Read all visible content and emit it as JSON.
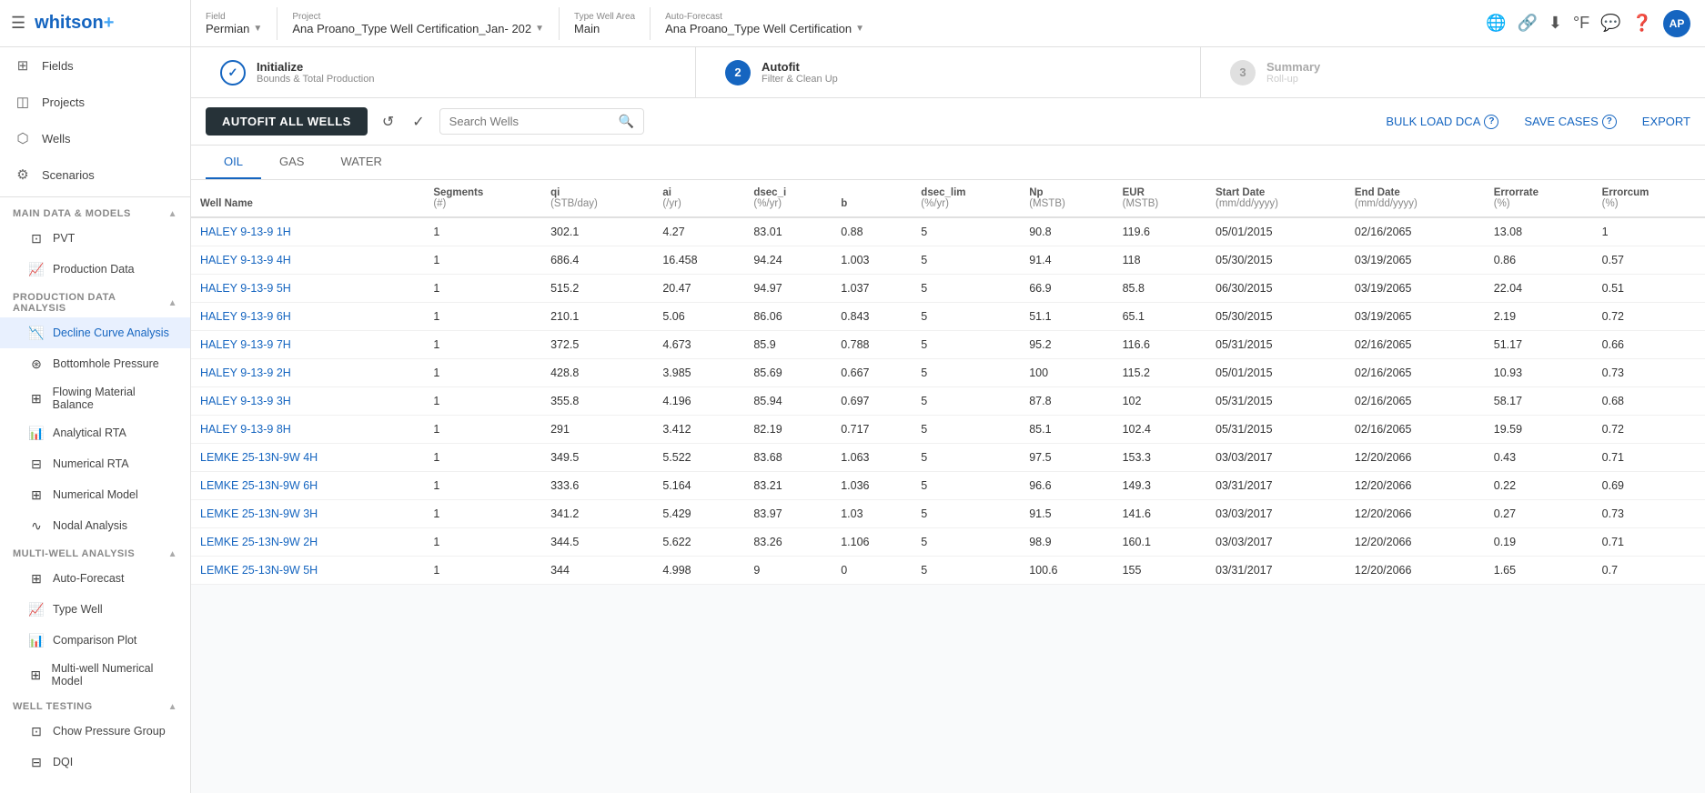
{
  "sidebar": {
    "logo": "whitson",
    "logo_plus": "+",
    "nav_items": [
      {
        "id": "fields",
        "label": "Fields",
        "icon": "⊞"
      },
      {
        "id": "projects",
        "label": "Projects",
        "icon": "📁"
      },
      {
        "id": "wells",
        "label": "Wells",
        "icon": "⬡"
      },
      {
        "id": "scenarios",
        "label": "Scenarios",
        "icon": "⚙"
      }
    ],
    "sections": [
      {
        "id": "main-data-models",
        "label": "Main Data & Models",
        "items": [
          {
            "id": "pvt",
            "label": "PVT",
            "icon": "⊡"
          },
          {
            "id": "production-data",
            "label": "Production Data",
            "icon": "📈"
          }
        ]
      },
      {
        "id": "production-data-analysis",
        "label": "Production Data Analysis",
        "items": [
          {
            "id": "decline-curve-analysis",
            "label": "Decline Curve Analysis",
            "icon": "📉",
            "active": true
          },
          {
            "id": "bottomhole-pressure",
            "label": "Bottomhole Pressure",
            "icon": "⊛"
          },
          {
            "id": "flowing-material-balance",
            "label": "Flowing Material Balance",
            "icon": "⊞"
          },
          {
            "id": "analytical-rta",
            "label": "Analytical RTA",
            "icon": "📊"
          },
          {
            "id": "numerical-rta",
            "label": "Numerical RTA",
            "icon": "⊟"
          },
          {
            "id": "numerical-model",
            "label": "Numerical Model",
            "icon": "⊞"
          },
          {
            "id": "nodal-analysis",
            "label": "Nodal Analysis",
            "icon": "∿"
          }
        ]
      },
      {
        "id": "multi-well-analysis",
        "label": "Multi-Well Analysis",
        "items": [
          {
            "id": "auto-forecast",
            "label": "Auto-Forecast",
            "icon": "⊞",
            "active": false
          },
          {
            "id": "type-well",
            "label": "Type Well",
            "icon": "📈"
          },
          {
            "id": "comparison-plot",
            "label": "Comparison Plot",
            "icon": "📊"
          },
          {
            "id": "multi-well-numerical-model",
            "label": "Multi-well Numerical Model",
            "icon": "⊞"
          }
        ]
      },
      {
        "id": "well-testing",
        "label": "Well Testing",
        "items": [
          {
            "id": "chow-pressure-group",
            "label": "Chow Pressure Group",
            "icon": "⊡"
          },
          {
            "id": "dqi",
            "label": "DQI",
            "icon": "⊟"
          }
        ]
      }
    ]
  },
  "topbar": {
    "field_label": "Field",
    "field_value": "Permian",
    "project_label": "Project",
    "project_value": "Ana Proano_Type Well Certification_Jan- 202",
    "type_well_area_label": "Type Well Area",
    "type_well_area_value": "Main",
    "auto_forecast_label": "Auto-Forecast",
    "auto_forecast_value": "Ana Proano_Type Well Certification"
  },
  "steps": [
    {
      "id": "initialize",
      "number": "✓",
      "title": "Initialize",
      "subtitle": "Bounds & Total Production",
      "state": "check"
    },
    {
      "id": "autofit",
      "number": "2",
      "title": "Autofit",
      "subtitle": "Filter & Clean Up",
      "state": "active"
    },
    {
      "id": "summary",
      "number": "3",
      "title": "Summary",
      "subtitle": "Roll-up",
      "state": "inactive"
    }
  ],
  "toolbar": {
    "autofit_button": "AUTOFIT ALL WELLS",
    "search_placeholder": "Search Wells",
    "bulk_load_dca": "BULK LOAD DCA",
    "save_cases": "SAVE CASES",
    "export": "EXPORT"
  },
  "tabs": [
    {
      "id": "oil",
      "label": "OIL",
      "active": true
    },
    {
      "id": "gas",
      "label": "GAS",
      "active": false
    },
    {
      "id": "water",
      "label": "WATER",
      "active": false
    }
  ],
  "table": {
    "columns": [
      {
        "id": "well-name",
        "label": "Well Name",
        "unit": ""
      },
      {
        "id": "segments",
        "label": "Segments",
        "unit": "(#)"
      },
      {
        "id": "qi",
        "label": "qi",
        "unit": "(STB/day)"
      },
      {
        "id": "ai",
        "label": "ai",
        "unit": "(/yr)"
      },
      {
        "id": "dsec_i",
        "label": "dsec_i",
        "unit": "(%/yr)"
      },
      {
        "id": "b",
        "label": "b",
        "unit": ""
      },
      {
        "id": "dsec_lim",
        "label": "dsec_lim",
        "unit": "(%/yr)"
      },
      {
        "id": "np",
        "label": "Np",
        "unit": "(MSTB)"
      },
      {
        "id": "eur",
        "label": "EUR",
        "unit": "(MSTB)"
      },
      {
        "id": "start-date",
        "label": "Start Date",
        "unit": "(mm/dd/yyyy)"
      },
      {
        "id": "end-date",
        "label": "End Date",
        "unit": "(mm/dd/yyyy)"
      },
      {
        "id": "error-rate",
        "label": "Errorrate",
        "unit": "(%)"
      },
      {
        "id": "error-cum",
        "label": "Errorcum",
        "unit": "(%)"
      }
    ],
    "rows": [
      {
        "well_name": "HALEY 9-13-9 1H",
        "segments": 1,
        "qi": 302.1,
        "ai": 4.27,
        "dsec_i": 83.01,
        "b": 0.88,
        "dsec_lim": 5,
        "np": 90.8,
        "eur": 119.6,
        "start_date": "05/01/2015",
        "end_date": "02/16/2065",
        "error_rate": 13.08,
        "error_cum": 1
      },
      {
        "well_name": "HALEY 9-13-9 4H",
        "segments": 1,
        "qi": 686.4,
        "ai": 16.458,
        "dsec_i": 94.24,
        "b": 1.003,
        "dsec_lim": 5,
        "np": 91.4,
        "eur": 118,
        "start_date": "05/30/2015",
        "end_date": "03/19/2065",
        "error_rate": 0.86,
        "error_cum": 0.57
      },
      {
        "well_name": "HALEY 9-13-9 5H",
        "segments": 1,
        "qi": 515.2,
        "ai": 20.47,
        "dsec_i": 94.97,
        "b": 1.037,
        "dsec_lim": 5,
        "np": 66.9,
        "eur": 85.8,
        "start_date": "06/30/2015",
        "end_date": "03/19/2065",
        "error_rate": 22.04,
        "error_cum": 0.51
      },
      {
        "well_name": "HALEY 9-13-9 6H",
        "segments": 1,
        "qi": 210.1,
        "ai": 5.06,
        "dsec_i": 86.06,
        "b": 0.843,
        "dsec_lim": 5,
        "np": 51.1,
        "eur": 65.1,
        "start_date": "05/30/2015",
        "end_date": "03/19/2065",
        "error_rate": 2.19,
        "error_cum": 0.72
      },
      {
        "well_name": "HALEY 9-13-9 7H",
        "segments": 1,
        "qi": 372.5,
        "ai": 4.673,
        "dsec_i": 85.9,
        "b": 0.788,
        "dsec_lim": 5,
        "np": 95.2,
        "eur": 116.6,
        "start_date": "05/31/2015",
        "end_date": "02/16/2065",
        "error_rate": 51.17,
        "error_cum": 0.66
      },
      {
        "well_name": "HALEY 9-13-9 2H",
        "segments": 1,
        "qi": 428.8,
        "ai": 3.985,
        "dsec_i": 85.69,
        "b": 0.667,
        "dsec_lim": 5,
        "np": 100,
        "eur": 115.2,
        "start_date": "05/01/2015",
        "end_date": "02/16/2065",
        "error_rate": 10.93,
        "error_cum": 0.73
      },
      {
        "well_name": "HALEY 9-13-9 3H",
        "segments": 1,
        "qi": 355.8,
        "ai": 4.196,
        "dsec_i": 85.94,
        "b": 0.697,
        "dsec_lim": 5,
        "np": 87.8,
        "eur": 102,
        "start_date": "05/31/2015",
        "end_date": "02/16/2065",
        "error_rate": 58.17,
        "error_cum": 0.68
      },
      {
        "well_name": "HALEY 9-13-9 8H",
        "segments": 1,
        "qi": 291,
        "ai": 3.412,
        "dsec_i": 82.19,
        "b": 0.717,
        "dsec_lim": 5,
        "np": 85.1,
        "eur": 102.4,
        "start_date": "05/31/2015",
        "end_date": "02/16/2065",
        "error_rate": 19.59,
        "error_cum": 0.72
      },
      {
        "well_name": "LEMKE 25-13N-9W 4H",
        "segments": 1,
        "qi": 349.5,
        "ai": 5.522,
        "dsec_i": 83.68,
        "b": 1.063,
        "dsec_lim": 5,
        "np": 97.5,
        "eur": 153.3,
        "start_date": "03/03/2017",
        "end_date": "12/20/2066",
        "error_rate": 0.43,
        "error_cum": 0.71
      },
      {
        "well_name": "LEMKE 25-13N-9W 6H",
        "segments": 1,
        "qi": 333.6,
        "ai": 5.164,
        "dsec_i": 83.21,
        "b": 1.036,
        "dsec_lim": 5,
        "np": 96.6,
        "eur": 149.3,
        "start_date": "03/31/2017",
        "end_date": "12/20/2066",
        "error_rate": 0.22,
        "error_cum": 0.69
      },
      {
        "well_name": "LEMKE 25-13N-9W 3H",
        "segments": 1,
        "qi": 341.2,
        "ai": 5.429,
        "dsec_i": 83.97,
        "b": 1.03,
        "dsec_lim": 5,
        "np": 91.5,
        "eur": 141.6,
        "start_date": "03/03/2017",
        "end_date": "12/20/2066",
        "error_rate": 0.27,
        "error_cum": 0.73
      },
      {
        "well_name": "LEMKE 25-13N-9W 2H",
        "segments": 1,
        "qi": 344.5,
        "ai": 5.622,
        "dsec_i": 83.26,
        "b": 1.106,
        "dsec_lim": 5,
        "np": 98.9,
        "eur": 160.1,
        "start_date": "03/03/2017",
        "end_date": "12/20/2066",
        "error_rate": 0.19,
        "error_cum": 0.71
      },
      {
        "well_name": "LEMKE 25-13N-9W 5H",
        "segments": 1,
        "qi": 344.0,
        "ai": 4.998,
        "dsec_i": 9.0,
        "b": 0.0,
        "dsec_lim": 5,
        "np": 100.6,
        "eur": 155.0,
        "start_date": "03/31/2017",
        "end_date": "12/20/2066",
        "error_rate": 1.65,
        "error_cum": 0.7
      }
    ]
  }
}
